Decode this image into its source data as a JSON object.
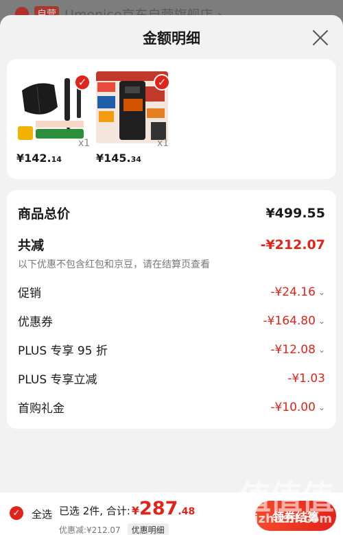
{
  "background": {
    "tag": "自营",
    "shop": "Umenice京东自营旗舰店 ›"
  },
  "sheet": {
    "title": "金额明细"
  },
  "products": [
    {
      "price_int": "¥142.",
      "price_dec": "14",
      "qty": "x1"
    },
    {
      "price_int": "¥145.",
      "price_dec": "34",
      "qty": "x1"
    }
  ],
  "detail": {
    "total_label": "商品总价",
    "total_value": "¥499.55",
    "reduce_label": "共减",
    "reduce_value": "-¥212.07",
    "note": "以下优惠不包含红包和京豆，请在结算页查看",
    "items": [
      {
        "label": "促销",
        "value": "-¥24.16",
        "chevron": true
      },
      {
        "label": "优惠券",
        "value": "-¥164.80",
        "chevron": true
      },
      {
        "label": "PLUS 专享 95 折",
        "value": "-¥12.08",
        "chevron": true
      },
      {
        "label": "PLUS 专享立减",
        "value": "-¥1.03",
        "chevron": false
      },
      {
        "label": "首购礼金",
        "value": "-¥10.00",
        "chevron": true
      }
    ]
  },
  "bottom": {
    "select_all": "全选",
    "selected_text": "已选 2件, 合计:",
    "yen": "¥",
    "total_int": "287",
    "total_dec": ".48",
    "saved": "优惠减:¥212.07",
    "detail_chip": "优惠明细",
    "checkout": "领券结算"
  },
  "watermark": {
    "text": "值值值",
    "url": "zhizhizhi.com"
  },
  "colors": {
    "accent": "#e2231a"
  }
}
